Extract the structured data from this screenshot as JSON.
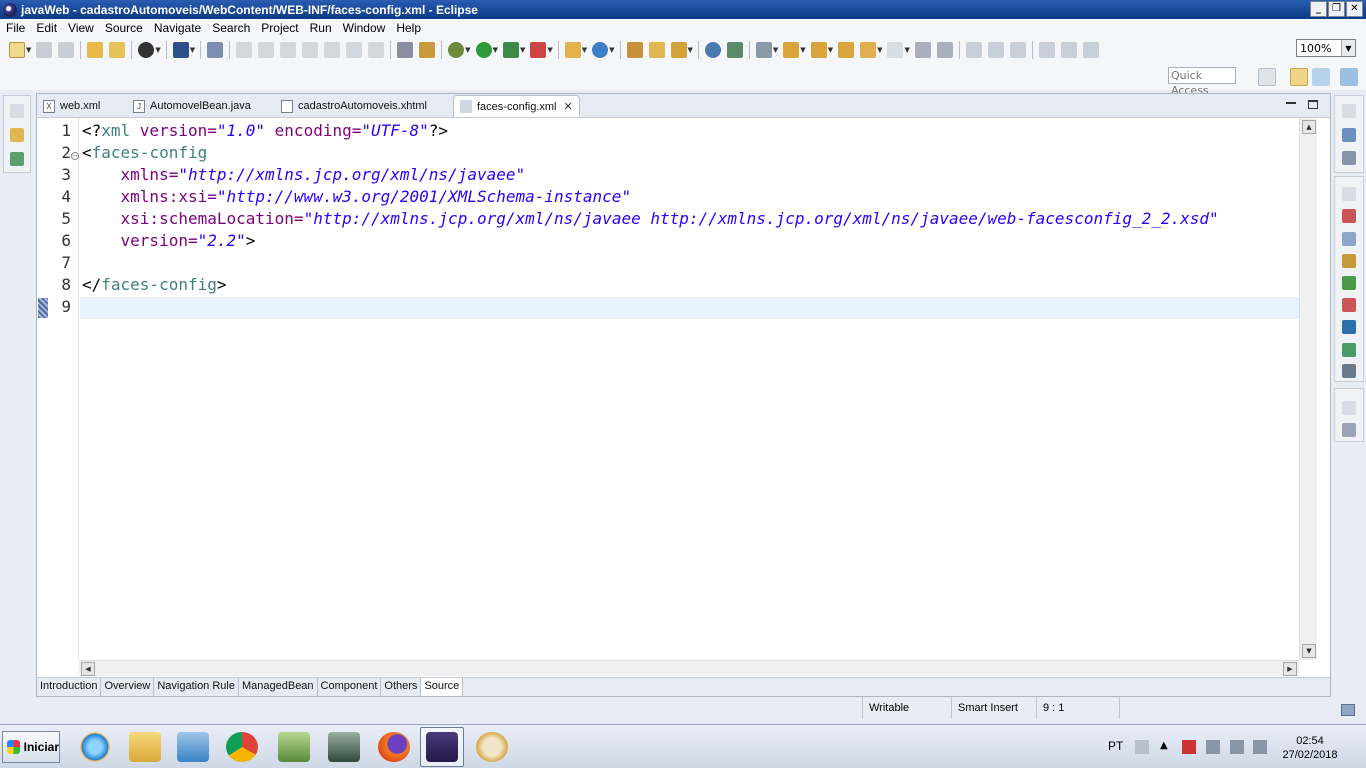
{
  "window": {
    "title": "javaWeb - cadastroAutomoveis/WebContent/WEB-INF/faces-config.xml - Eclipse",
    "controls": {
      "minimize": "_",
      "restore": "❐",
      "close": "✕"
    }
  },
  "menu": [
    "File",
    "Edit",
    "View",
    "Source",
    "Navigate",
    "Search",
    "Project",
    "Run",
    "Window",
    "Help"
  ],
  "toolbar": {
    "zoom": "100%",
    "quick_access_placeholder": "Quick Access"
  },
  "editor": {
    "tabs": [
      {
        "label": "web.xml",
        "icon": "xml-file-icon",
        "icon_glyph": "X"
      },
      {
        "label": "AutomovelBean.java",
        "icon": "java-file-icon",
        "icon_glyph": "J"
      },
      {
        "label": "cadastroAutomoveis.xhtml",
        "icon": "xhtml-file-icon",
        "icon_glyph": ""
      },
      {
        "label": "faces-config.xml",
        "icon": "faces-config-icon",
        "icon_glyph": ""
      }
    ],
    "active_tab": "faces-config.xml",
    "close_glyph": "✕",
    "line_numbers": [
      "1",
      "2",
      "3",
      "4",
      "5",
      "6",
      "7",
      "8",
      "9"
    ],
    "lines": [
      {
        "indent": "",
        "parts": [
          [
            "p",
            "<?"
          ],
          [
            "t",
            "xml "
          ],
          [
            "a",
            "version="
          ],
          [
            "v",
            "\"1.0\""
          ],
          [
            "a",
            " encoding="
          ],
          [
            "v",
            "\"UTF-8\""
          ],
          [
            "p",
            "?>"
          ]
        ]
      },
      {
        "indent": "",
        "parts": [
          [
            "p",
            "<"
          ],
          [
            "t",
            "faces-config"
          ]
        ]
      },
      {
        "indent": "    ",
        "parts": [
          [
            "a",
            "xmlns="
          ],
          [
            "v",
            "\"http://xmlns.jcp.org/xml/ns/javaee\""
          ]
        ]
      },
      {
        "indent": "    ",
        "parts": [
          [
            "a",
            "xmlns:xsi="
          ],
          [
            "v",
            "\"http://www.w3.org/2001/XMLSchema-instance\""
          ]
        ]
      },
      {
        "indent": "    ",
        "parts": [
          [
            "a",
            "xsi:schemaLocation="
          ],
          [
            "v",
            "\"http://xmlns.jcp.org/xml/ns/javaee http://xmlns.jcp.org/xml/ns/javaee/web-facesconfig_2_2.xsd\""
          ]
        ]
      },
      {
        "indent": "    ",
        "parts": [
          [
            "a",
            "version="
          ],
          [
            "v",
            "\"2.2\""
          ],
          [
            "p",
            ">"
          ]
        ]
      },
      {
        "indent": "",
        "parts": []
      },
      {
        "indent": "",
        "parts": [
          [
            "p",
            "</"
          ],
          [
            "t",
            "faces-config"
          ],
          [
            "p",
            ">"
          ]
        ]
      },
      {
        "indent": "",
        "parts": []
      }
    ],
    "bottom_tabs": [
      "Introduction",
      "Overview",
      "Navigation Rule",
      "ManagedBean",
      "Component",
      "Others",
      "Source"
    ],
    "active_bottom_tab": "Source"
  },
  "status": {
    "writable": "Writable",
    "insert_mode": "Smart Insert",
    "position": "9 : 1"
  },
  "taskbar": {
    "start_label": "Iniciar",
    "language": "PT",
    "time": "02:54",
    "date": "27/02/2018"
  }
}
